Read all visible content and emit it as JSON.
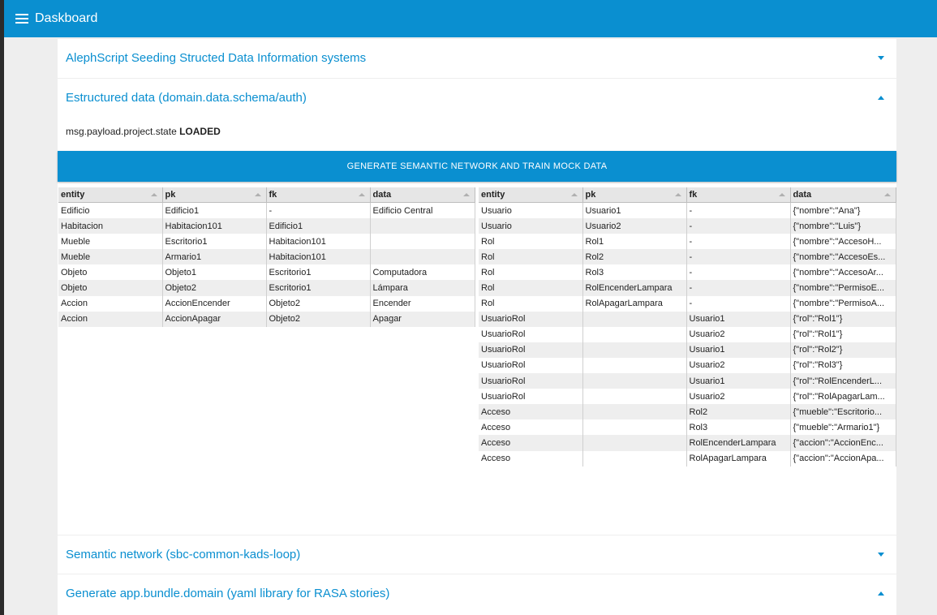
{
  "app": {
    "title": "Daskboard"
  },
  "panels": {
    "p1": {
      "title": "AlephScript Seeding Structed Data Information systems"
    },
    "p2": {
      "title": "Estructured data (domain.data.schema/auth)",
      "state_label": "msg.payload.project.state",
      "state_value": "LOADED",
      "button_label": "GENERATE SEMANTIC NETWORK AND TRAIN MOCK DATA"
    },
    "p3": {
      "title": "Semantic network (sbc-common-kads-loop)"
    },
    "p4": {
      "title": "Generate app.bundle.domain (yaml library for RASA stories)"
    }
  },
  "tables": {
    "columns": [
      "entity",
      "pk",
      "fk",
      "data"
    ],
    "domain": [
      [
        "Edificio",
        "Edificio1",
        "-",
        "Edificio Central"
      ],
      [
        "Habitacion",
        "Habitacion101",
        "Edificio1",
        ""
      ],
      [
        "Mueble",
        "Escritorio1",
        "Habitacion101",
        ""
      ],
      [
        "Mueble",
        "Armario1",
        "Habitacion101",
        ""
      ],
      [
        "Objeto",
        "Objeto1",
        "Escritorio1",
        "Computadora"
      ],
      [
        "Objeto",
        "Objeto2",
        "Escritorio1",
        "Lámpara"
      ],
      [
        "Accion",
        "AccionEncender",
        "Objeto2",
        "Encender"
      ],
      [
        "Accion",
        "AccionApagar",
        "Objeto2",
        "Apagar"
      ]
    ],
    "auth": [
      [
        "Usuario",
        "Usuario1",
        "-",
        "{\"nombre\":\"Ana\"}"
      ],
      [
        "Usuario",
        "Usuario2",
        "-",
        "{\"nombre\":\"Luis\"}"
      ],
      [
        "Rol",
        "Rol1",
        "-",
        "{\"nombre\":\"AccesoH..."
      ],
      [
        "Rol",
        "Rol2",
        "-",
        "{\"nombre\":\"AccesoEs..."
      ],
      [
        "Rol",
        "Rol3",
        "-",
        "{\"nombre\":\"AccesoAr..."
      ],
      [
        "Rol",
        "RolEncenderLampara",
        "-",
        "{\"nombre\":\"PermisoE..."
      ],
      [
        "Rol",
        "RolApagarLampara",
        "-",
        "{\"nombre\":\"PermisoA..."
      ],
      [
        "UsuarioRol",
        "",
        "Usuario1",
        "{\"rol\":\"Rol1\"}"
      ],
      [
        "UsuarioRol",
        "",
        "Usuario2",
        "{\"rol\":\"Rol1\"}"
      ],
      [
        "UsuarioRol",
        "",
        "Usuario1",
        "{\"rol\":\"Rol2\"}"
      ],
      [
        "UsuarioRol",
        "",
        "Usuario2",
        "{\"rol\":\"Rol3\"}"
      ],
      [
        "UsuarioRol",
        "",
        "Usuario1",
        "{\"rol\":\"RolEncenderL..."
      ],
      [
        "UsuarioRol",
        "",
        "Usuario2",
        "{\"rol\":\"RolApagarLam..."
      ],
      [
        "Acceso",
        "",
        "Rol2",
        "{\"mueble\":\"Escritorio..."
      ],
      [
        "Acceso",
        "",
        "Rol3",
        "{\"mueble\":\"Armario1\"}"
      ],
      [
        "Acceso",
        "",
        "RolEncenderLampara",
        "{\"accion\":\"AccionEnc..."
      ],
      [
        "Acceso",
        "",
        "RolApagarLampara",
        "{\"accion\":\"AccionApa..."
      ]
    ]
  }
}
